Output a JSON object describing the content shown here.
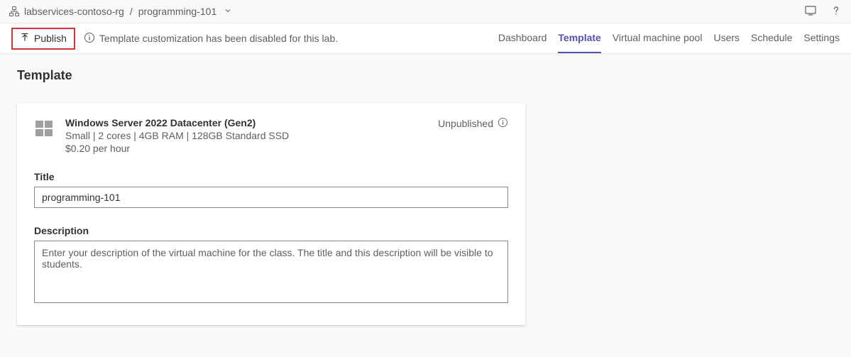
{
  "breadcrumb": {
    "parent": "labservices-contoso-rg",
    "current": "programming-101"
  },
  "actions": {
    "publish_label": "Publish",
    "info_message": "Template customization has been disabled for this lab."
  },
  "tabs": [
    {
      "label": "Dashboard",
      "active": false
    },
    {
      "label": "Template",
      "active": true
    },
    {
      "label": "Virtual machine pool",
      "active": false
    },
    {
      "label": "Users",
      "active": false
    },
    {
      "label": "Schedule",
      "active": false
    },
    {
      "label": "Settings",
      "active": false
    }
  ],
  "page": {
    "title": "Template"
  },
  "vm": {
    "name": "Windows Server 2022 Datacenter (Gen2)",
    "spec": "Small | 2 cores | 4GB RAM | 128GB Standard SSD",
    "price": "$0.20 per hour",
    "status": "Unpublished"
  },
  "form": {
    "title_label": "Title",
    "title_value": "programming-101",
    "description_label": "Description",
    "description_placeholder": "Enter your description of the virtual machine for the class. The title and this description will be visible to students."
  }
}
